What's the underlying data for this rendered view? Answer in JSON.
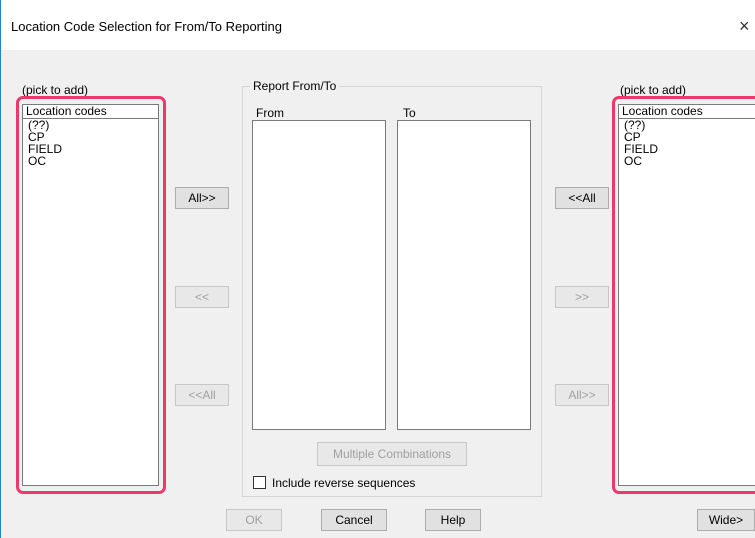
{
  "window": {
    "title": "Location Code Selection for From/To Reporting",
    "close_glyph": "×"
  },
  "left_panel": {
    "hint": "(pick to add)",
    "header": "Location codes",
    "items": [
      "(??)",
      "CP",
      "FIELD",
      "OC"
    ]
  },
  "right_panel": {
    "hint": "(pick to add)",
    "header": "Location codes",
    "items": [
      "(??)",
      "CP",
      "FIELD",
      "OC"
    ]
  },
  "report_group": {
    "title": "Report From/To",
    "from_label": "From",
    "to_label": "To",
    "multiple_combinations": "Multiple Combinations",
    "include_reverse": "Include reverse sequences",
    "include_reverse_checked": false
  },
  "left_buttons": {
    "all_right": "All>>",
    "remove_one": "<<",
    "remove_all": "<<All"
  },
  "right_buttons": {
    "all_left": "<<All",
    "remove_one": ">>",
    "remove_all": "All>>"
  },
  "bottom_buttons": {
    "ok": "OK",
    "cancel": "Cancel",
    "help": "Help",
    "wide": "Wide>"
  },
  "colors": {
    "highlight": "#f0376b",
    "window_border": "#1e88c8",
    "disabled_text": "#a0a0a0"
  }
}
